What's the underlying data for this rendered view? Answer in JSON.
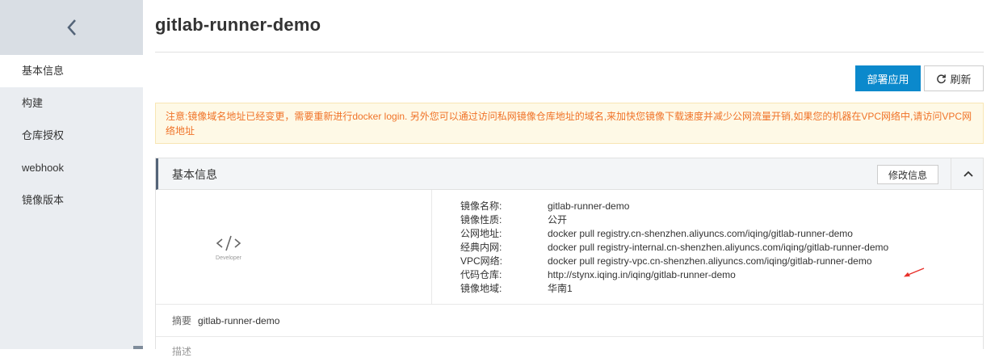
{
  "sidebar": {
    "back_icon": "chevron-left-icon",
    "items": [
      {
        "label": "基本信息",
        "active": true
      },
      {
        "label": "构建"
      },
      {
        "label": "仓库授权"
      },
      {
        "label": "webhook"
      },
      {
        "label": "镜像版本"
      }
    ]
  },
  "header": {
    "title": "gitlab-runner-demo"
  },
  "toolbar": {
    "deploy_label": "部署应用",
    "refresh_label": "刷新",
    "refresh_icon": "refresh-icon",
    "accent": "#0b89cc"
  },
  "notice": {
    "text": "注意:镜像域名地址已经变更，需要重新进行docker login. 另外您可以通过访问私网镜像仓库地址的域名,来加快您镜像下载速度并减少公网流量开销,如果您的机器在VPC网络中,请访问VPC网络地址",
    "color": "#f07328"
  },
  "panel": {
    "title": "基本信息",
    "edit_label": "修改信息",
    "collapse_icon": "chevron-up-icon",
    "logo_label": "Developer",
    "rows": [
      {
        "key": "镜像名称:",
        "value": "gitlab-runner-demo"
      },
      {
        "key": "镜像性质:",
        "value": "公开"
      },
      {
        "key": "公网地址:",
        "value": "docker pull registry.cn-shenzhen.aliyuncs.com/iqing/gitlab-runner-demo"
      },
      {
        "key": "经典内网:",
        "value": "docker pull registry-internal.cn-shenzhen.aliyuncs.com/iqing/gitlab-runner-demo"
      },
      {
        "key": "VPC网络:",
        "value": "docker pull registry-vpc.cn-shenzhen.aliyuncs.com/iqing/gitlab-runner-demo"
      },
      {
        "key": "代码仓库:",
        "value": "http://stynx.iqing.in/iqing/gitlab-runner-demo"
      },
      {
        "key": "镜像地域:",
        "value": "华南1"
      }
    ],
    "summary": {
      "key": "摘要",
      "value": "gitlab-runner-demo"
    },
    "description": {
      "key": "描述"
    }
  }
}
